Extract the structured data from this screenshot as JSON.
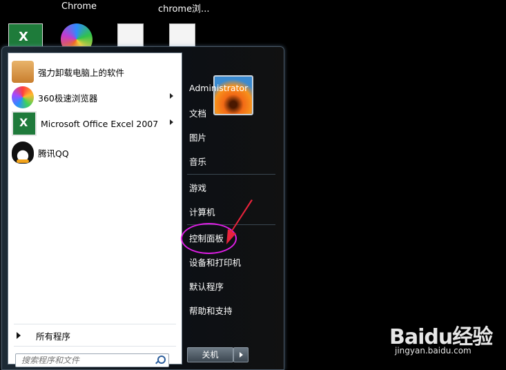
{
  "desktop": {
    "icons": [
      {
        "name": "excel-desktop-icon",
        "label": ""
      },
      {
        "name": "chrome-desktop-icon",
        "label": "Chrome"
      },
      {
        "name": "document-icon",
        "label": ""
      },
      {
        "name": "chrome-doc-icon",
        "label": "chrome浏..."
      }
    ]
  },
  "start_menu": {
    "programs": [
      {
        "label": "强力卸载电脑上的软件",
        "icon": "uninstall-icon",
        "has_submenu": false
      },
      {
        "label": "360极速浏览器",
        "icon": "360-browser-icon",
        "has_submenu": true
      },
      {
        "label": "Microsoft Office Excel 2007",
        "icon": "excel-icon",
        "has_submenu": true
      },
      {
        "label": "腾讯QQ",
        "icon": "qq-icon",
        "has_submenu": false
      }
    ],
    "all_programs_label": "所有程序",
    "search_placeholder": "搜索程序和文件",
    "right_items": {
      "user": "Administrator",
      "documents": "文档",
      "pictures": "图片",
      "music": "音乐",
      "games": "游戏",
      "computer": "计算机",
      "control_panel": "控制面板",
      "devices_printers": "设备和打印机",
      "default_programs": "默认程序",
      "help_support": "帮助和支持"
    },
    "shutdown_label": "关机"
  },
  "annotations": {
    "highlight_color": "#e01ee7",
    "arrow_color": "#e8233b"
  },
  "watermark": {
    "brand": "Baidu经验",
    "url": "jingyan.baidu.com"
  }
}
